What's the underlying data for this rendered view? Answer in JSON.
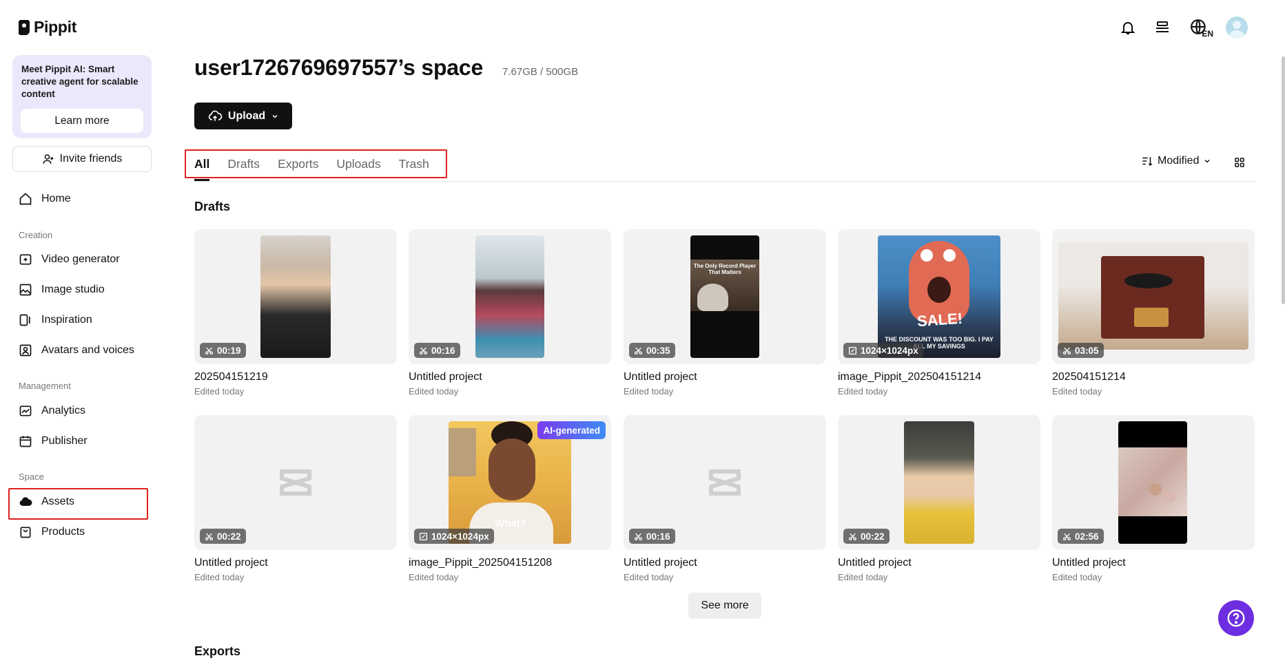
{
  "app": {
    "logo_text": "Pippit"
  },
  "promo": {
    "text": "Meet Pippit AI: Smart creative agent for scalable content",
    "button": "Learn more"
  },
  "invite": {
    "label": "Invite friends"
  },
  "nav": {
    "home": "Home",
    "creation_section": "Creation",
    "video_generator": "Video generator",
    "image_studio": "Image studio",
    "inspiration": "Inspiration",
    "avatars": "Avatars and voices",
    "management_section": "Management",
    "analytics": "Analytics",
    "publisher": "Publisher",
    "space_section": "Space",
    "assets": "Assets",
    "products": "Products"
  },
  "header": {
    "title": "user1726769697557’s space",
    "storage": "7.67GB / 500GB",
    "upload": "Upload",
    "language_code": "EN"
  },
  "tabs": [
    "All",
    "Drafts",
    "Exports",
    "Uploads",
    "Trash"
  ],
  "sort": {
    "label": "Modified"
  },
  "sections": {
    "drafts": "Drafts",
    "exports": "Exports"
  },
  "cards": [
    {
      "title": "202504151219",
      "sub": "Edited today",
      "badge": "00:19",
      "type": "video"
    },
    {
      "title": "Untitled project",
      "sub": "Edited today",
      "badge": "00:16",
      "type": "video"
    },
    {
      "title": "Untitled project",
      "sub": "Edited today",
      "badge": "00:35",
      "type": "video"
    },
    {
      "title": "image_Pippit_202504151214",
      "sub": "Edited today",
      "badge": "1024×1024px",
      "type": "image"
    },
    {
      "title": "202504151214",
      "sub": "Edited today",
      "badge": "03:05",
      "type": "video"
    },
    {
      "title": "Untitled project",
      "sub": "Edited today",
      "badge": "00:22",
      "type": "video"
    },
    {
      "title": "image_Pippit_202504151208",
      "sub": "Edited today",
      "badge": "1024×1024px",
      "type": "image",
      "ai": "AI-generated"
    },
    {
      "title": "Untitled project",
      "sub": "Edited today",
      "badge": "00:16",
      "type": "video"
    },
    {
      "title": "Untitled project",
      "sub": "Edited today",
      "badge": "00:22",
      "type": "video"
    },
    {
      "title": "Untitled project",
      "sub": "Edited today",
      "badge": "02:56",
      "type": "video"
    }
  ],
  "thumb_text": {
    "card3": "The Only Record Player That Matters",
    "card4_big": "SALE!",
    "card4_small": "THE DISCOUNT WAS TOO BIG. I PAY ALL MY SAVINGS",
    "card7": "What?"
  },
  "see_more": "See more",
  "colors": {
    "accent": "#6c2ee0",
    "highlight": "#e02020",
    "primary": "#111111"
  }
}
